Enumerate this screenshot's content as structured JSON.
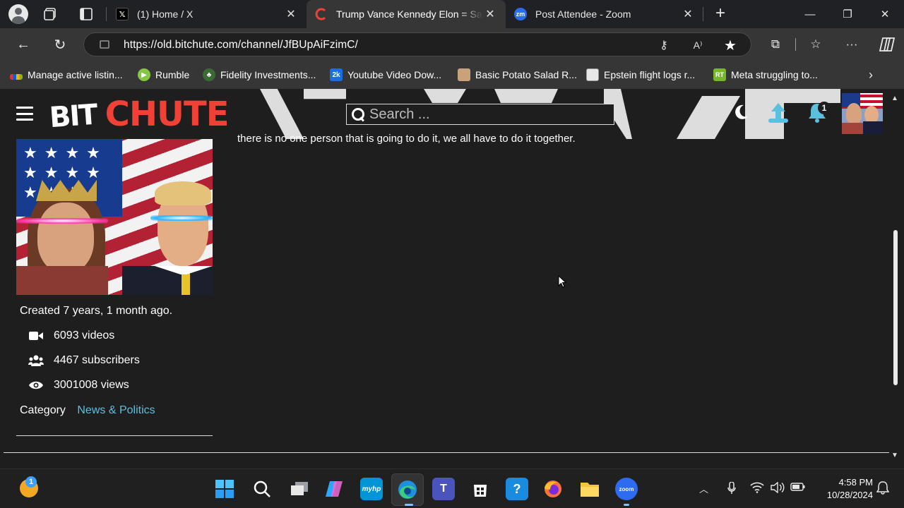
{
  "browser": {
    "tabs": [
      {
        "title": "(1) Home / X",
        "icon": "x-logo-icon"
      },
      {
        "title": "Trump Vance Kennedy Elon = Sav",
        "icon": "bitchute-icon",
        "active": true
      },
      {
        "title": "Post Attendee - Zoom",
        "icon": "zoom-icon"
      }
    ],
    "url": "https://old.bitchute.com/channel/JfBUpAiFzimC/",
    "bookmarks": [
      {
        "label": "Manage active listin...",
        "icon": "ebay-icon"
      },
      {
        "label": "Rumble",
        "icon": "rumble-icon"
      },
      {
        "label": "Fidelity Investments...",
        "icon": "fidelity-icon"
      },
      {
        "label": "Youtube Video Dow...",
        "icon": "2k-icon",
        "icon_text": "2k"
      },
      {
        "label": "Basic Potato Salad R...",
        "icon": "recipe-thumbnail-icon"
      },
      {
        "label": "Epstein flight logs r...",
        "icon": "document-icon"
      },
      {
        "label": "Meta struggling to...",
        "icon": "rt-icon",
        "icon_text": "RT"
      }
    ]
  },
  "site": {
    "logo_left": "BIT",
    "logo_right": "CHUTE",
    "search_placeholder": "Search ...",
    "notification_count": "1",
    "description_tail": "there is no one person that is going to do it, we all have to do it together."
  },
  "channel": {
    "created": "Created 7 years, 1 month ago.",
    "stats": [
      {
        "icon": "video-camera-icon",
        "text": "6093 videos"
      },
      {
        "icon": "users-icon",
        "text": "4467 subscribers"
      },
      {
        "icon": "eye-icon",
        "text": "3001008 views"
      }
    ],
    "category_label": "Category",
    "category_value": "News & Politics"
  },
  "taskbar": {
    "weather_badge": "1",
    "apps": [
      "windows-start-icon",
      "search-icon",
      "task-view-icon",
      "copilot-icon",
      "myhp-icon",
      "edge-icon",
      "teams-icon",
      "store-icon",
      "tips-icon",
      "firefox-icon",
      "file-explorer-icon",
      "zoom-icon"
    ],
    "myhp_text": "myhp",
    "zoom_text": "zoom",
    "time": "4:58 PM",
    "date": "10/28/2024"
  },
  "colors": {
    "accent_red": "#ef4136",
    "link": "#5bc0de",
    "page_bg": "#1e1e1e",
    "chrome_bg": "#363636"
  }
}
